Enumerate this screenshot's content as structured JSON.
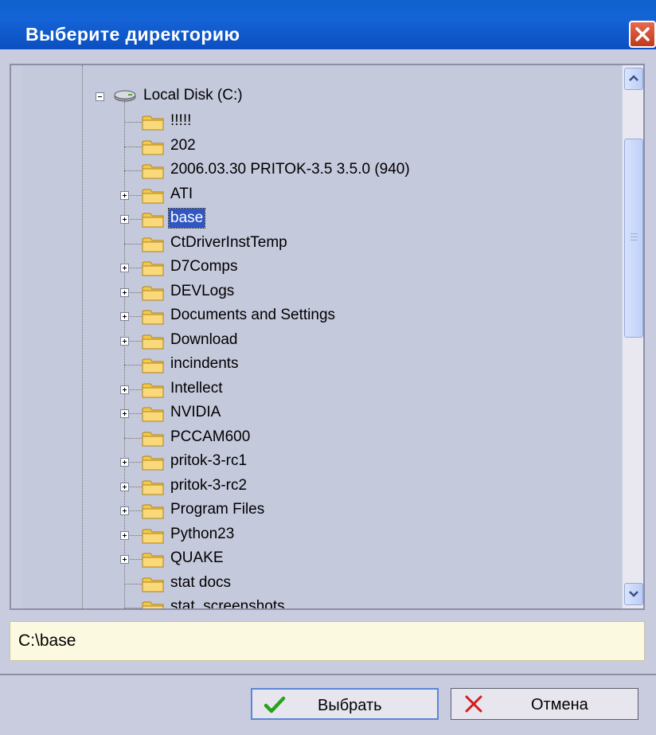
{
  "dialog": {
    "title": "Выберите директорию"
  },
  "tree": {
    "root": {
      "label": "Local Disk (C:)",
      "expanded": true
    },
    "items": [
      {
        "label": "!!!!!",
        "expandable": false,
        "selected": false
      },
      {
        "label": "202",
        "expandable": false,
        "selected": false
      },
      {
        "label": "2006.03.30 PRITOK-3.5 3.5.0 (940)",
        "expandable": false,
        "selected": false
      },
      {
        "label": "ATI",
        "expandable": true,
        "selected": false
      },
      {
        "label": "base",
        "expandable": true,
        "selected": true
      },
      {
        "label": "CtDriverInstTemp",
        "expandable": false,
        "selected": false
      },
      {
        "label": "D7Comps",
        "expandable": true,
        "selected": false
      },
      {
        "label": "DEVLogs",
        "expandable": true,
        "selected": false
      },
      {
        "label": "Documents and Settings",
        "expandable": true,
        "selected": false
      },
      {
        "label": "Download",
        "expandable": true,
        "selected": false
      },
      {
        "label": "incindents",
        "expandable": false,
        "selected": false
      },
      {
        "label": "Intellect",
        "expandable": true,
        "selected": false
      },
      {
        "label": "NVIDIA",
        "expandable": true,
        "selected": false
      },
      {
        "label": "PCCAM600",
        "expandable": false,
        "selected": false
      },
      {
        "label": "pritok-3-rc1",
        "expandable": true,
        "selected": false
      },
      {
        "label": "pritok-3-rc2",
        "expandable": true,
        "selected": false
      },
      {
        "label": "Program Files",
        "expandable": true,
        "selected": false
      },
      {
        "label": "Python23",
        "expandable": true,
        "selected": false
      },
      {
        "label": "QUAKE",
        "expandable": true,
        "selected": false
      },
      {
        "label": "stat docs",
        "expandable": false,
        "selected": false
      },
      {
        "label": "stat_screenshots",
        "expandable": false,
        "selected": false
      }
    ]
  },
  "path": {
    "value": "C:\\base"
  },
  "buttons": {
    "ok_label": "Выбрать",
    "cancel_label": "Отмена"
  },
  "colors": {
    "titlebar": "#0b57cf",
    "selection": "#2f56c3",
    "folder": "#f3c94b",
    "ok_icon": "#27a31a",
    "cancel_icon": "#d31d1d"
  }
}
